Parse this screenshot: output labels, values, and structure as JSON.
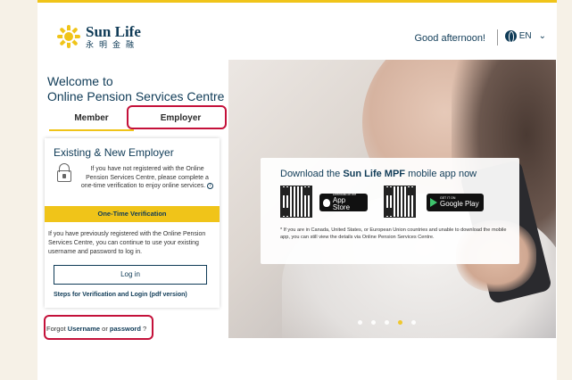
{
  "header": {
    "logo_en": "Sun Life",
    "logo_zh": "永明金融",
    "greeting": "Good afternoon!",
    "language": "EN"
  },
  "welcome": {
    "line1": "Welcome to",
    "line2": "Online Pension Services Centre"
  },
  "tabs": [
    {
      "label": "Member",
      "active": false
    },
    {
      "label": "Employer",
      "active": true
    }
  ],
  "card": {
    "title": "Existing & New Employer",
    "desc": "If you have not registered with the Online Pension Services Centre, please complete a one-time verification to enjoy online services.",
    "otv_button": "One-Time Verification",
    "desc2": "If you have previously registered with the Online Pension Services Centre, you can continue to use your existing username and password to log in.",
    "login_button": "Log in",
    "steps_link": "Steps for Verification and Login (pdf version)"
  },
  "forgot": {
    "prefix": "Forgot",
    "username": "Username",
    "or": "or",
    "password": "password",
    "suffix": "?"
  },
  "hero": {
    "title_pre": "Download the",
    "title_brand": "Sun Life MPF",
    "title_post": "mobile app now",
    "apple_small": "Download on the",
    "apple_big": "App Store",
    "gplay_small": "GET IT ON",
    "gplay_big": "Google Play",
    "note": "* If you are in Canada, United States, or European Union countries and unable to download the mobile app, you can still view the details via Online Pension Services Centre.",
    "slides": 5,
    "active_slide": 4
  },
  "colors": {
    "accent": "#f0c419",
    "brand": "#0f3b57",
    "highlight": "#c4113a"
  }
}
